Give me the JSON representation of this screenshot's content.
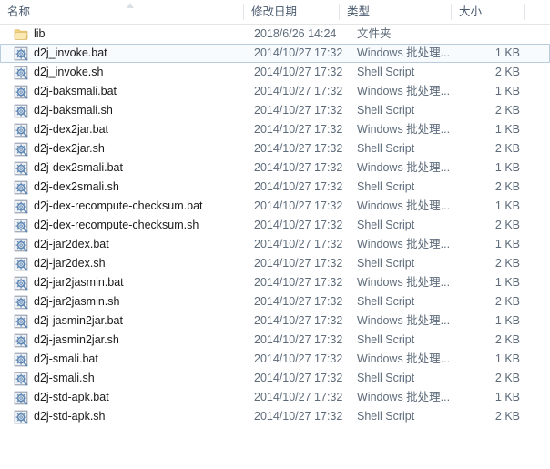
{
  "window": {
    "type": "file-explorer-details-view",
    "background": "#ffffff"
  },
  "columns": {
    "name": "名称",
    "date_modified": "修改日期",
    "type": "类型",
    "size": "大小"
  },
  "colors": {
    "header_text": "#4a5b70",
    "row_text": "#1a1a1a",
    "secondary_text": "#5d6b7a",
    "selection_fill": "#f7fbfe",
    "selection_border": "#b8ccdd",
    "folder_icon": "#f5d98a",
    "script_icon": "#7fa8cc"
  },
  "selection": {
    "selected_index": 1,
    "selected_name": "d2j_invoke.bat"
  },
  "rows": [
    {
      "name": "lib",
      "date": "2018/6/26 14:24",
      "type": "文件夹",
      "size": "",
      "icon": "folder-icon",
      "selected": false
    },
    {
      "name": "d2j_invoke.bat",
      "date": "2014/10/27 17:32",
      "type": "Windows 批处理...",
      "size": "1 KB",
      "icon": "batch-script-icon",
      "selected": true
    },
    {
      "name": "d2j_invoke.sh",
      "date": "2014/10/27 17:32",
      "type": "Shell Script",
      "size": "2 KB",
      "icon": "shell-script-icon",
      "selected": false
    },
    {
      "name": "d2j-baksmali.bat",
      "date": "2014/10/27 17:32",
      "type": "Windows 批处理...",
      "size": "1 KB",
      "icon": "batch-script-icon",
      "selected": false
    },
    {
      "name": "d2j-baksmali.sh",
      "date": "2014/10/27 17:32",
      "type": "Shell Script",
      "size": "2 KB",
      "icon": "shell-script-icon",
      "selected": false
    },
    {
      "name": "d2j-dex2jar.bat",
      "date": "2014/10/27 17:32",
      "type": "Windows 批处理...",
      "size": "1 KB",
      "icon": "batch-script-icon",
      "selected": false
    },
    {
      "name": "d2j-dex2jar.sh",
      "date": "2014/10/27 17:32",
      "type": "Shell Script",
      "size": "2 KB",
      "icon": "shell-script-icon",
      "selected": false
    },
    {
      "name": "d2j-dex2smali.bat",
      "date": "2014/10/27 17:32",
      "type": "Windows 批处理...",
      "size": "1 KB",
      "icon": "batch-script-icon",
      "selected": false
    },
    {
      "name": "d2j-dex2smali.sh",
      "date": "2014/10/27 17:32",
      "type": "Shell Script",
      "size": "2 KB",
      "icon": "shell-script-icon",
      "selected": false
    },
    {
      "name": "d2j-dex-recompute-checksum.bat",
      "date": "2014/10/27 17:32",
      "type": "Windows 批处理...",
      "size": "1 KB",
      "icon": "batch-script-icon",
      "selected": false
    },
    {
      "name": "d2j-dex-recompute-checksum.sh",
      "date": "2014/10/27 17:32",
      "type": "Shell Script",
      "size": "2 KB",
      "icon": "shell-script-icon",
      "selected": false
    },
    {
      "name": "d2j-jar2dex.bat",
      "date": "2014/10/27 17:32",
      "type": "Windows 批处理...",
      "size": "1 KB",
      "icon": "batch-script-icon",
      "selected": false
    },
    {
      "name": "d2j-jar2dex.sh",
      "date": "2014/10/27 17:32",
      "type": "Shell Script",
      "size": "2 KB",
      "icon": "shell-script-icon",
      "selected": false
    },
    {
      "name": "d2j-jar2jasmin.bat",
      "date": "2014/10/27 17:32",
      "type": "Windows 批处理...",
      "size": "1 KB",
      "icon": "batch-script-icon",
      "selected": false
    },
    {
      "name": "d2j-jar2jasmin.sh",
      "date": "2014/10/27 17:32",
      "type": "Shell Script",
      "size": "2 KB",
      "icon": "shell-script-icon",
      "selected": false
    },
    {
      "name": "d2j-jasmin2jar.bat",
      "date": "2014/10/27 17:32",
      "type": "Windows 批处理...",
      "size": "1 KB",
      "icon": "batch-script-icon",
      "selected": false
    },
    {
      "name": "d2j-jasmin2jar.sh",
      "date": "2014/10/27 17:32",
      "type": "Shell Script",
      "size": "2 KB",
      "icon": "shell-script-icon",
      "selected": false
    },
    {
      "name": "d2j-smali.bat",
      "date": "2014/10/27 17:32",
      "type": "Windows 批处理...",
      "size": "1 KB",
      "icon": "batch-script-icon",
      "selected": false
    },
    {
      "name": "d2j-smali.sh",
      "date": "2014/10/27 17:32",
      "type": "Shell Script",
      "size": "2 KB",
      "icon": "shell-script-icon",
      "selected": false
    },
    {
      "name": "d2j-std-apk.bat",
      "date": "2014/10/27 17:32",
      "type": "Windows 批处理...",
      "size": "1 KB",
      "icon": "batch-script-icon",
      "selected": false
    },
    {
      "name": "d2j-std-apk.sh",
      "date": "2014/10/27 17:32",
      "type": "Shell Script",
      "size": "2 KB",
      "icon": "shell-script-icon",
      "selected": false
    }
  ]
}
